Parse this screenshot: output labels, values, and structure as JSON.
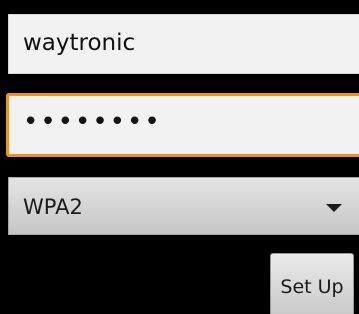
{
  "form": {
    "ssid_value": "waytronic",
    "password_value": "••••••••",
    "security_value": "WPA2",
    "setup_label": "Set Up"
  },
  "icons": {
    "dropdown_arrow": "chevron-down-icon"
  },
  "colors": {
    "background": "#000000",
    "field_background": "#f2f2f2",
    "focus_border": "#f0921a"
  }
}
